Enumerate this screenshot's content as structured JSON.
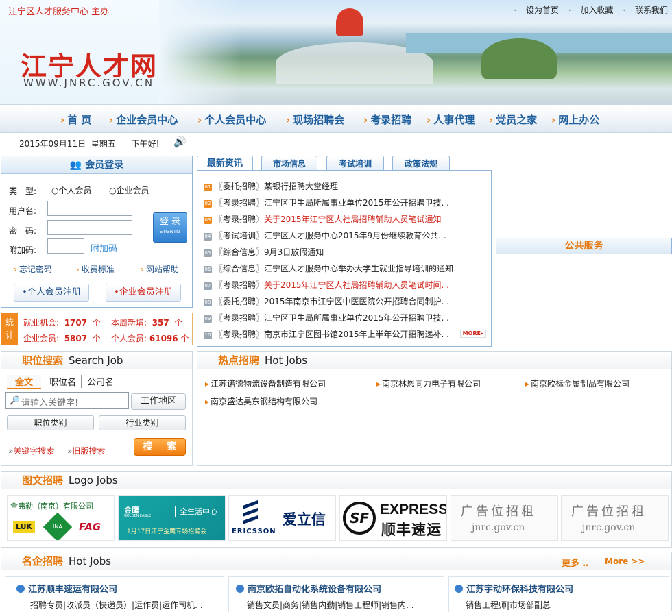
{
  "header": {
    "title": "江宁区人才服务中心 主办",
    "links": [
      "设为首页",
      "加入收藏",
      "联系我们"
    ],
    "logo_cn": "江宁人才网",
    "logo_en": "WWW.JNRC.GOV.CN"
  },
  "nav": [
    "首 页",
    "企业会员中心",
    "个人会员中心",
    "现场招聘会",
    "考录招聘",
    "人事代理",
    "党员之家",
    "网上办公"
  ],
  "datebar": {
    "date": "2015年09月11日",
    "weekday": "星期五",
    "greeting": "下午好!"
  },
  "login": {
    "title": "会员登录",
    "type_label": "类　型:",
    "type_options": [
      "个人会员",
      "企业会员"
    ],
    "username_label": "用户名:",
    "password_label": "密　码:",
    "captcha_label": "附加码:",
    "captcha_text": "附加码",
    "login_button": "登 录",
    "login_button_sub": "SIGNIN",
    "links": [
      "忘记密码",
      "收费标准",
      "网站帮助"
    ],
    "register_personal": "个人会员注册",
    "register_company": "企业会员注册"
  },
  "stats": {
    "tag": [
      "统",
      "计"
    ],
    "jobs_label": "就业机会:",
    "jobs_value": "1707",
    "jobs_unit": "个",
    "week_label": "本周新增:",
    "week_value": "357",
    "week_unit": "个",
    "company_label": "企业会员:",
    "company_value": "5807",
    "company_unit": "个",
    "person_label": "个人会员:",
    "person_value": "61096",
    "person_unit": "个"
  },
  "news": {
    "tabs": [
      "最新资讯",
      "市场信息",
      "考试培训",
      "政策法规"
    ],
    "items": [
      {
        "num": "01",
        "tag": "〖委托招聘〗",
        "title": "某银行招聘大堂经理",
        "red": false
      },
      {
        "num": "02",
        "tag": "〖考录招聘〗",
        "title": "江宁区卫生局所属事业单位2015年公开招聘卫技. .",
        "red": false
      },
      {
        "num": "03",
        "tag": "〖考录招聘〗",
        "title": "关于2015年江宁区人社局招聘辅助人员笔试通知",
        "red": true
      },
      {
        "num": "04",
        "tag": "〖考试培训〗",
        "title": "江宁区人才服务中心2015年9月份继续教育公共. .",
        "red": false
      },
      {
        "num": "05",
        "tag": "〖综合信息〗",
        "title": "9月3日放假通知",
        "red": false
      },
      {
        "num": "06",
        "tag": "〖综合信息〗",
        "title": "江宁区人才服务中心举办大学生就业指导培训的通知",
        "red": false
      },
      {
        "num": "07",
        "tag": "〖考录招聘〗",
        "title": "关于2015年江宁区人社局招聘辅助人员笔试时间. .",
        "red": true
      },
      {
        "num": "08",
        "tag": "〖委托招聘〗",
        "title": "2015年南京市江宁区中医医院公开招聘合同制护. .",
        "red": false
      },
      {
        "num": "09",
        "tag": "〖考录招聘〗",
        "title": "江宁区卫生局所属事业单位2015年公开招聘卫技. .",
        "red": false
      },
      {
        "num": "10",
        "tag": "〖考录招聘〗",
        "title": "南京市江宁区图书馆2015年上半年公开招聘递补. .",
        "red": false
      }
    ],
    "more": "MORE"
  },
  "public_service": "公共服务",
  "search": {
    "title_cn": "职位搜索",
    "title_en": "Search Job",
    "tabs": [
      "全文",
      "职位名",
      "公司名"
    ],
    "placeholder": "请输入关键字!",
    "area_button": "工作地区",
    "category_button": "职位类别",
    "industry_button": "行业类别",
    "keyword_link": "关键字搜索",
    "old_link": "旧版搜索",
    "go_button": "搜 索"
  },
  "hotjobs": {
    "title_cn": "热点招聘",
    "title_en": "Hot Jobs",
    "items": [
      "江苏诺德物流设备制造有限公司",
      "南京林恩同力电子有限公司",
      "南京欧标金属制品有限公司",
      "南京盛达昊东钢结构有限公司"
    ]
  },
  "logojobs": {
    "title_cn": "图文招聘",
    "title_en": "Logo Jobs",
    "tile1_title": "舍弗勒（南京）有限公司",
    "tile1_brands": [
      "LUK",
      "INA",
      "FAG"
    ],
    "tile2_brand": "金鹰",
    "tile2_brand_en": "GOLDEN EAGLE",
    "tile2_slogan": "全生活中心",
    "tile2_event": "1月17日江宁金鹰专场招聘会",
    "tile3_brand": "ERICSSON",
    "tile3_cn": "爱立信",
    "tile4_brand": "EXPRESS",
    "tile4_cn": "顺丰速运",
    "tile4_mark": "SF",
    "ad_text": "广告位招租",
    "ad_url": "jnrc.gov.cn"
  },
  "famous": {
    "title_cn": "名企招聘",
    "title_en": "Hot Jobs",
    "more_cn": "更多",
    "more_en": "More >>",
    "companies": [
      {
        "name": "江苏顺丰速运有限公司",
        "jobs": "招聘专员|收派员（快递员）|运作员|运作司机. ."
      },
      {
        "name": "南京欧拓自动化系统设备有限公司",
        "jobs": "销售文员|商务|销售内勤|销售工程师|销售内. ."
      },
      {
        "name": "江苏宇动环保科技有限公司",
        "jobs": "销售工程师|市场部副总"
      }
    ]
  }
}
